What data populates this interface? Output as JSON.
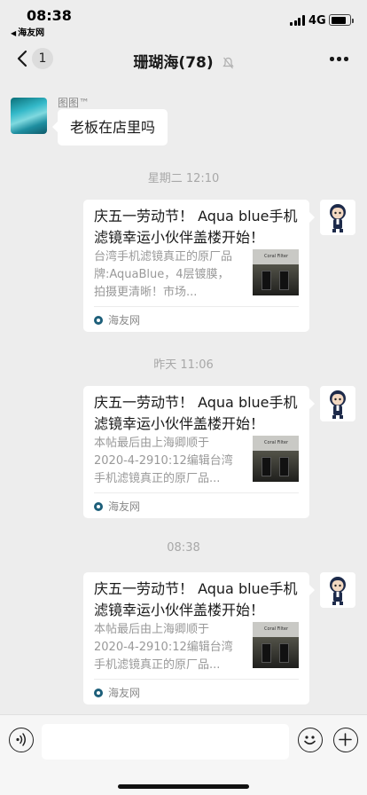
{
  "status_bar": {
    "time": "08:38",
    "back_app": "海友网",
    "network": "4G"
  },
  "nav": {
    "unread_count": "1",
    "title": "珊瑚海(78)"
  },
  "chat": {
    "first_message": {
      "sender": "图图™",
      "text": "老板在店里吗"
    },
    "timestamps": [
      "星期二 12:10",
      "昨天 11:06",
      "08:38"
    ],
    "cards": [
      {
        "title": "庆五一劳动节！ Aqua blue手机滤镜幸运小伙伴盖楼开始！",
        "desc": "台湾手机滤镜真正的原厂品牌:AquaBlue，4层镀膜，拍摄更清晰！市场...",
        "source": "海友网",
        "thumb_label": "Coral Filter"
      },
      {
        "title": "庆五一劳动节！ Aqua blue手机滤镜幸运小伙伴盖楼开始！",
        "desc": "本帖最后由上海卿顺于2020-4-2910:12编辑台湾手机滤镜真正的原厂品...",
        "source": "海友网",
        "thumb_label": "Coral Filter"
      },
      {
        "title": "庆五一劳动节！ Aqua blue手机滤镜幸运小伙伴盖楼开始！",
        "desc": "本帖最后由上海卿顺于2020-4-2910:12编辑台湾手机滤镜真正的原厂品...",
        "source": "海友网",
        "thumb_label": "Coral Filter"
      }
    ]
  },
  "input_bar": {
    "placeholder": ""
  },
  "icons": {
    "voice": "voice-icon",
    "emoji": "emoji-icon",
    "plus": "plus-icon",
    "mute": "mute-icon",
    "more": "more-icon",
    "back": "back-chevron-icon"
  },
  "colors": {
    "background": "#ededed",
    "bubble": "#ffffff",
    "timestamp": "#a8a8a8",
    "source_icon": "#1d5f7a"
  }
}
